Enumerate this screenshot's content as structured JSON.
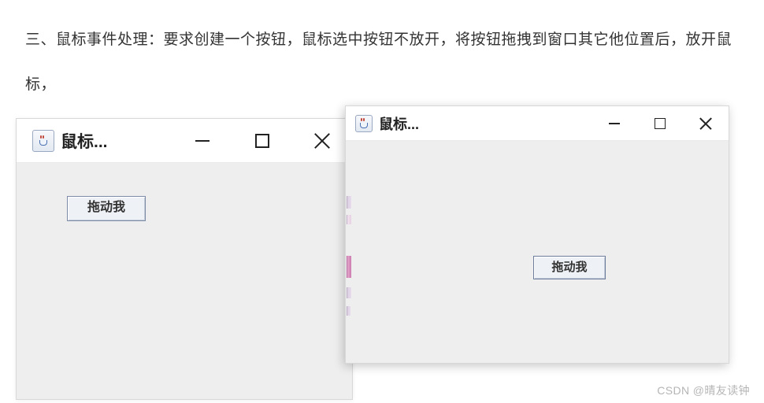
{
  "description": {
    "text": "三、鼠标事件处理：要求创建一个按钮，鼠标选中按钮不放开，将按钮拖拽到窗口其它他位置后，放开鼠标，"
  },
  "windows": {
    "left": {
      "title": "鼠标...",
      "button_label": "拖动我"
    },
    "right": {
      "title": "鼠标...",
      "button_label": "拖动我"
    }
  },
  "icons": {
    "java": "java-cup-icon",
    "minimize": "minimize-icon",
    "maximize": "maximize-icon",
    "close": "close-icon"
  },
  "watermark": "CSDN @晴友读钟",
  "colors": {
    "client_bg": "#eeeeee",
    "button_border": "#7b8aa6",
    "button_bg": "#eef1f6"
  }
}
